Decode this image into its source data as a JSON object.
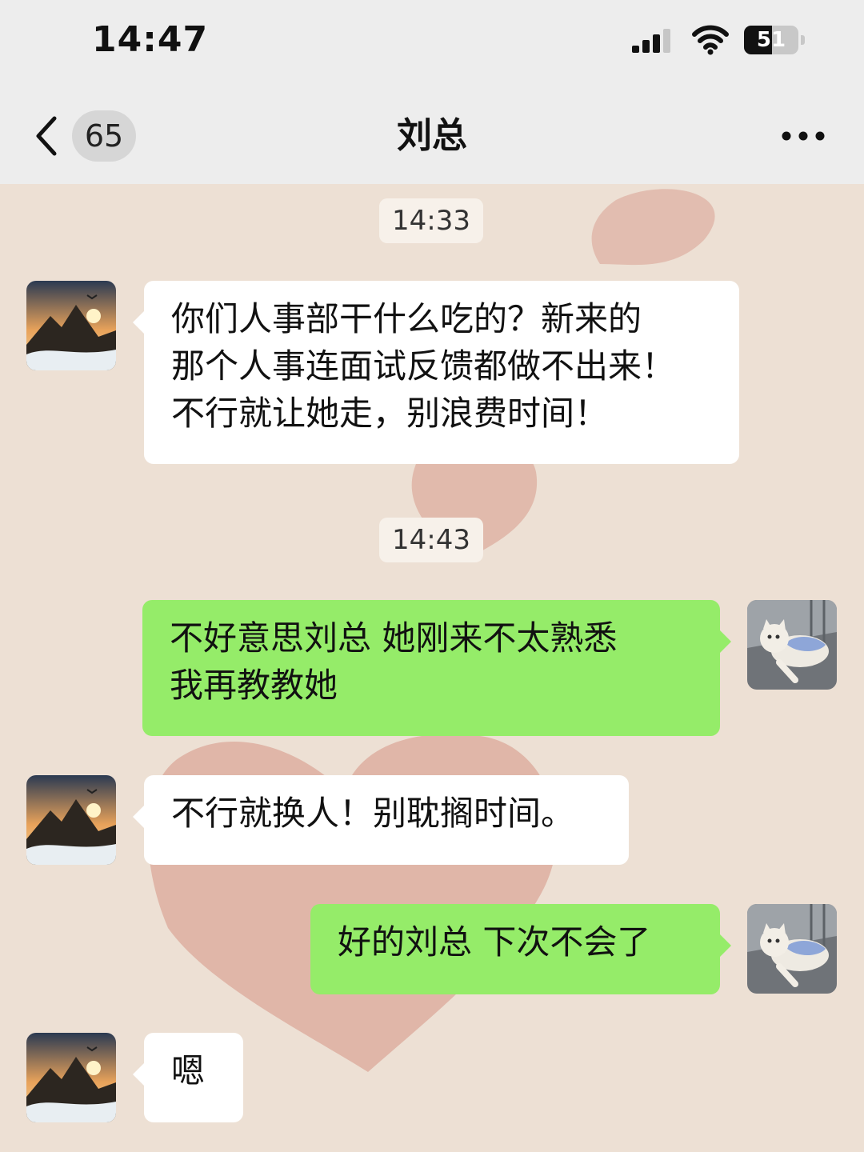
{
  "status_bar": {
    "time": "14:47",
    "battery_level": "51",
    "icons": [
      "signal-icon",
      "wifi-icon",
      "battery-icon"
    ]
  },
  "nav": {
    "back_icon": "chevron-left-icon",
    "unread_count": "65",
    "title": "刘总",
    "more_icon": "more-dots-icon"
  },
  "chat": {
    "timestamps": [
      "14:33",
      "14:43"
    ],
    "messages": [
      {
        "side": "in",
        "text": "你们人事部干什么吃的？新来的\n那个人事连面试反馈都做不出来！\n不行就让她走，别浪费时间！"
      },
      {
        "side": "out",
        "text": "不好意思刘总  她刚来不太熟悉\n我再教教她"
      },
      {
        "side": "in",
        "text": "不行就换人！别耽搁时间。"
      },
      {
        "side": "out",
        "text": "好的刘总  下次不会了"
      },
      {
        "side": "in",
        "text": "嗯"
      }
    ]
  },
  "colors": {
    "nav_background": "#ededed",
    "chat_background": "#ede0d4",
    "incoming_bubble": "#ffffff",
    "outgoing_bubble": "#95ec69",
    "background_heart": "#d9a091"
  }
}
